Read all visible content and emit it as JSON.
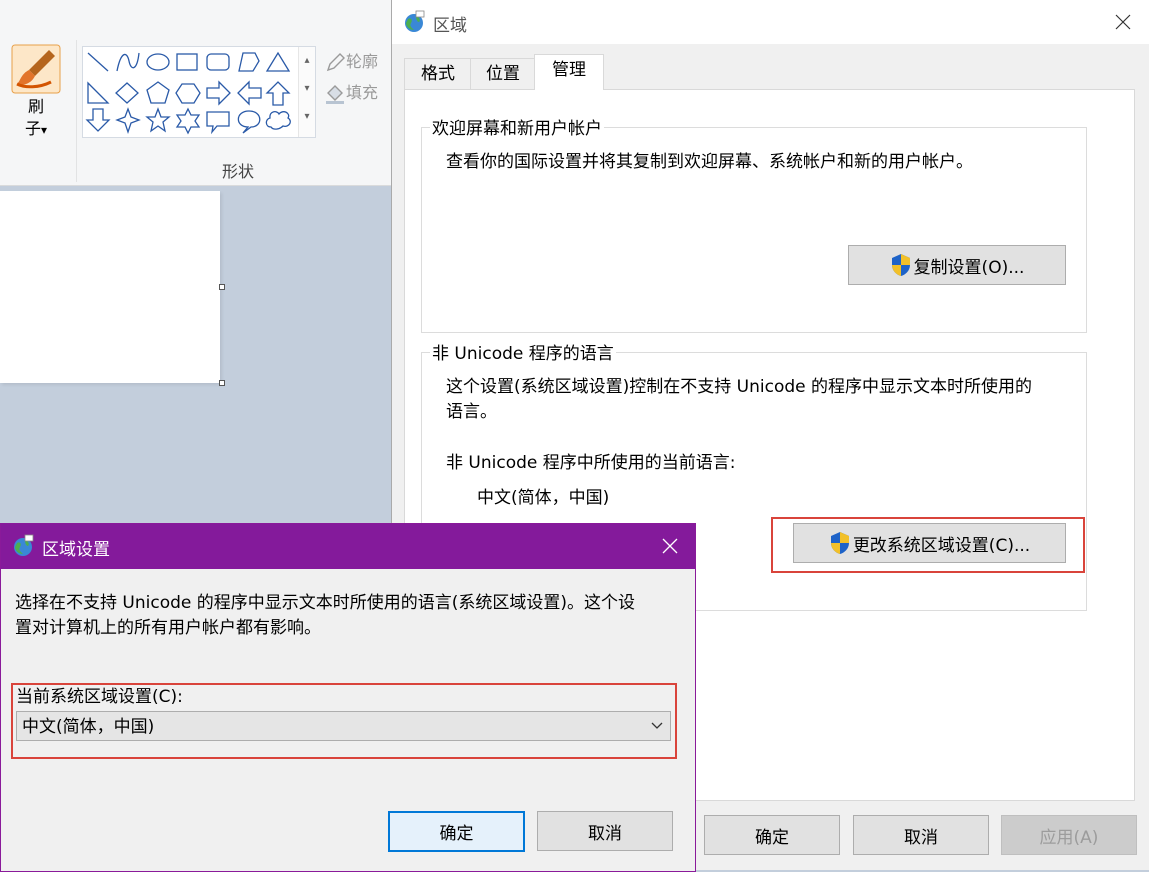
{
  "paint": {
    "brush_label_line1": "刷",
    "brush_label_line2": "子",
    "brush_dropdown_glyph": "▾",
    "outline_label": "轮廓",
    "fill_label": "填充",
    "shapes_group_label": "形状",
    "scroll_up": "▴",
    "scroll_down": "▾",
    "scroll_more": "▾"
  },
  "region_dialog": {
    "title": "区域",
    "tabs": [
      {
        "label": "格式",
        "active": false
      },
      {
        "label": "位置",
        "active": false
      },
      {
        "label": "管理",
        "active": true
      }
    ],
    "welcome_group": {
      "title": "欢迎屏幕和新用户帐户",
      "description": "查看你的国际设置并将其复制到欢迎屏幕、系统帐户和新的用户帐户。",
      "copy_button": "复制设置(O)..."
    },
    "non_unicode_group": {
      "title": "非 Unicode 程序的语言",
      "description_line1": "这个设置(系统区域设置)控制在不支持 Unicode 的程序中显示文本时所使用的",
      "description_line2": "语言。",
      "current_label": "非 Unicode 程序中所使用的当前语言:",
      "current_value": "中文(简体，中国)",
      "change_button": "更改系统区域设置(C)..."
    },
    "buttons": {
      "ok": "确定",
      "cancel": "取消",
      "apply": "应用(A)"
    }
  },
  "locale_dialog": {
    "title": "区域设置",
    "description_line1": "选择在不支持 Unicode 的程序中显示文本时所使用的语言(系统区域设置)。这个设",
    "description_line2": "置对计算机上的所有用户帐户都有影响。",
    "current_label": "当前系统区域设置(C):",
    "selected_value": "中文(简体，中国)",
    "buttons": {
      "ok": "确定",
      "cancel": "取消"
    }
  },
  "colors": {
    "accent_purple": "#841a9b",
    "highlight_red": "#d9443b",
    "focus_blue": "#0078d7"
  }
}
